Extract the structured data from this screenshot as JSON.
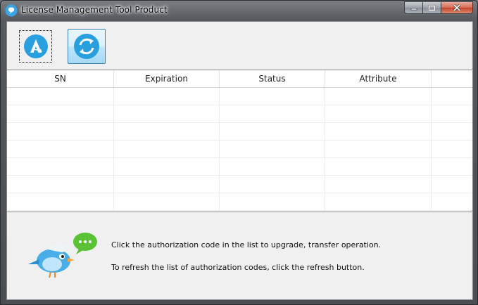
{
  "window": {
    "title": "License Management Tool Product",
    "caption_buttons": [
      "minimize-icon",
      "maximize-icon",
      "close-icon"
    ]
  },
  "toolbar": {
    "buttons": [
      {
        "name": "upgrade-button",
        "icon": "upgrade-arrow-icon",
        "color": "#2a9fe0"
      },
      {
        "name": "refresh-button",
        "icon": "refresh-icon",
        "color": "#2a9fe0"
      }
    ]
  },
  "table": {
    "columns": [
      "SN",
      "Expiration",
      "Status",
      "Attribute",
      ""
    ],
    "rows": [
      [
        "",
        "",
        "",
        "",
        ""
      ],
      [
        "",
        "",
        "",
        "",
        ""
      ],
      [
        "",
        "",
        "",
        "",
        ""
      ],
      [
        "",
        "",
        "",
        "",
        ""
      ],
      [
        "",
        "",
        "",
        "",
        ""
      ],
      [
        "",
        "",
        "",
        "",
        ""
      ],
      [
        "",
        "",
        "",
        "",
        ""
      ]
    ]
  },
  "help": {
    "mascot": "bird-mascot-icon",
    "line1": "Click the authorization code in the list to upgrade, transfer operation.",
    "line2": "To refresh the list of authorization codes, click the refresh button."
  },
  "colors": {
    "accent": "#2a9fe0",
    "chat_bubble": "#5bc236"
  }
}
